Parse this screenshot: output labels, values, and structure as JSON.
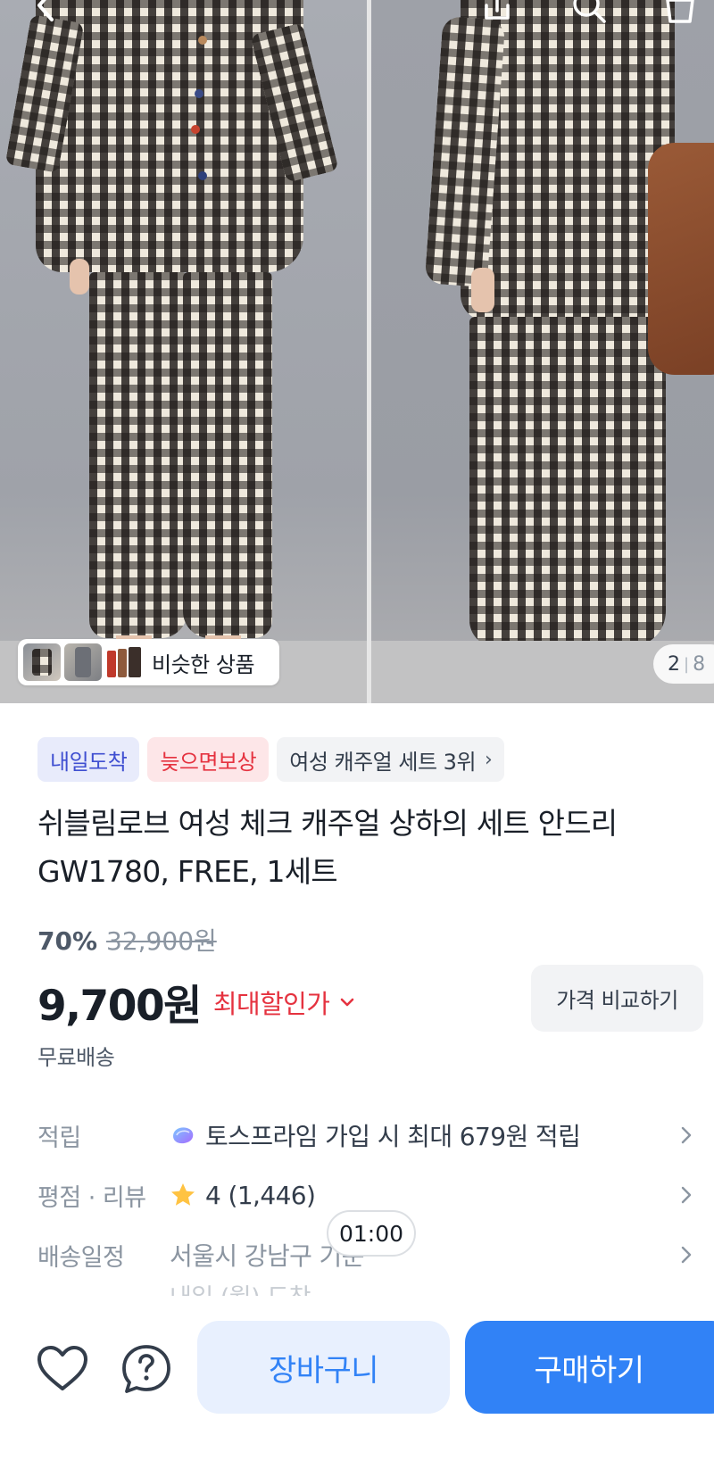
{
  "gallery": {
    "similar_label": "비슷한 상품",
    "page_current": "2",
    "page_total": "8"
  },
  "badges": {
    "arrival": "내일도착",
    "late_compensation": "늦으면보상",
    "ranking": "여성 캐주얼 세트 3위"
  },
  "product": {
    "title_line1": "쉬블림로브 여성 체크 캐주얼 상하의 세트 안드리",
    "title_line2": "GW1780, FREE, 1세트"
  },
  "pricing": {
    "discount_rate": "70%",
    "original_price": "32,900원",
    "price": "9,700원",
    "max_discount_label": "최대할인가",
    "compare_button": "가격 비교하기",
    "shipping": "무료배송"
  },
  "info_rows": [
    {
      "label": "적립",
      "value": "토스프라임 가입 시 최대 679원 적립",
      "icon": "toss-prime-icon"
    },
    {
      "label": "평점 · 리뷰",
      "value": "4 (1,446)",
      "icon": "star-icon"
    },
    {
      "label": "배송일정",
      "value": "서울시 강남구 기준",
      "icon": ""
    }
  ],
  "delivery_subtext": "내일 (월) 도착",
  "time_pill": "01:00",
  "actions": {
    "cart": "장바구니",
    "buy": "구매하기"
  },
  "colors": {
    "accent_blue": "#3182f6",
    "discount_red": "#e5323f",
    "badge_blue_text": "#3f4fd1",
    "star_yellow": "#ffc342"
  }
}
